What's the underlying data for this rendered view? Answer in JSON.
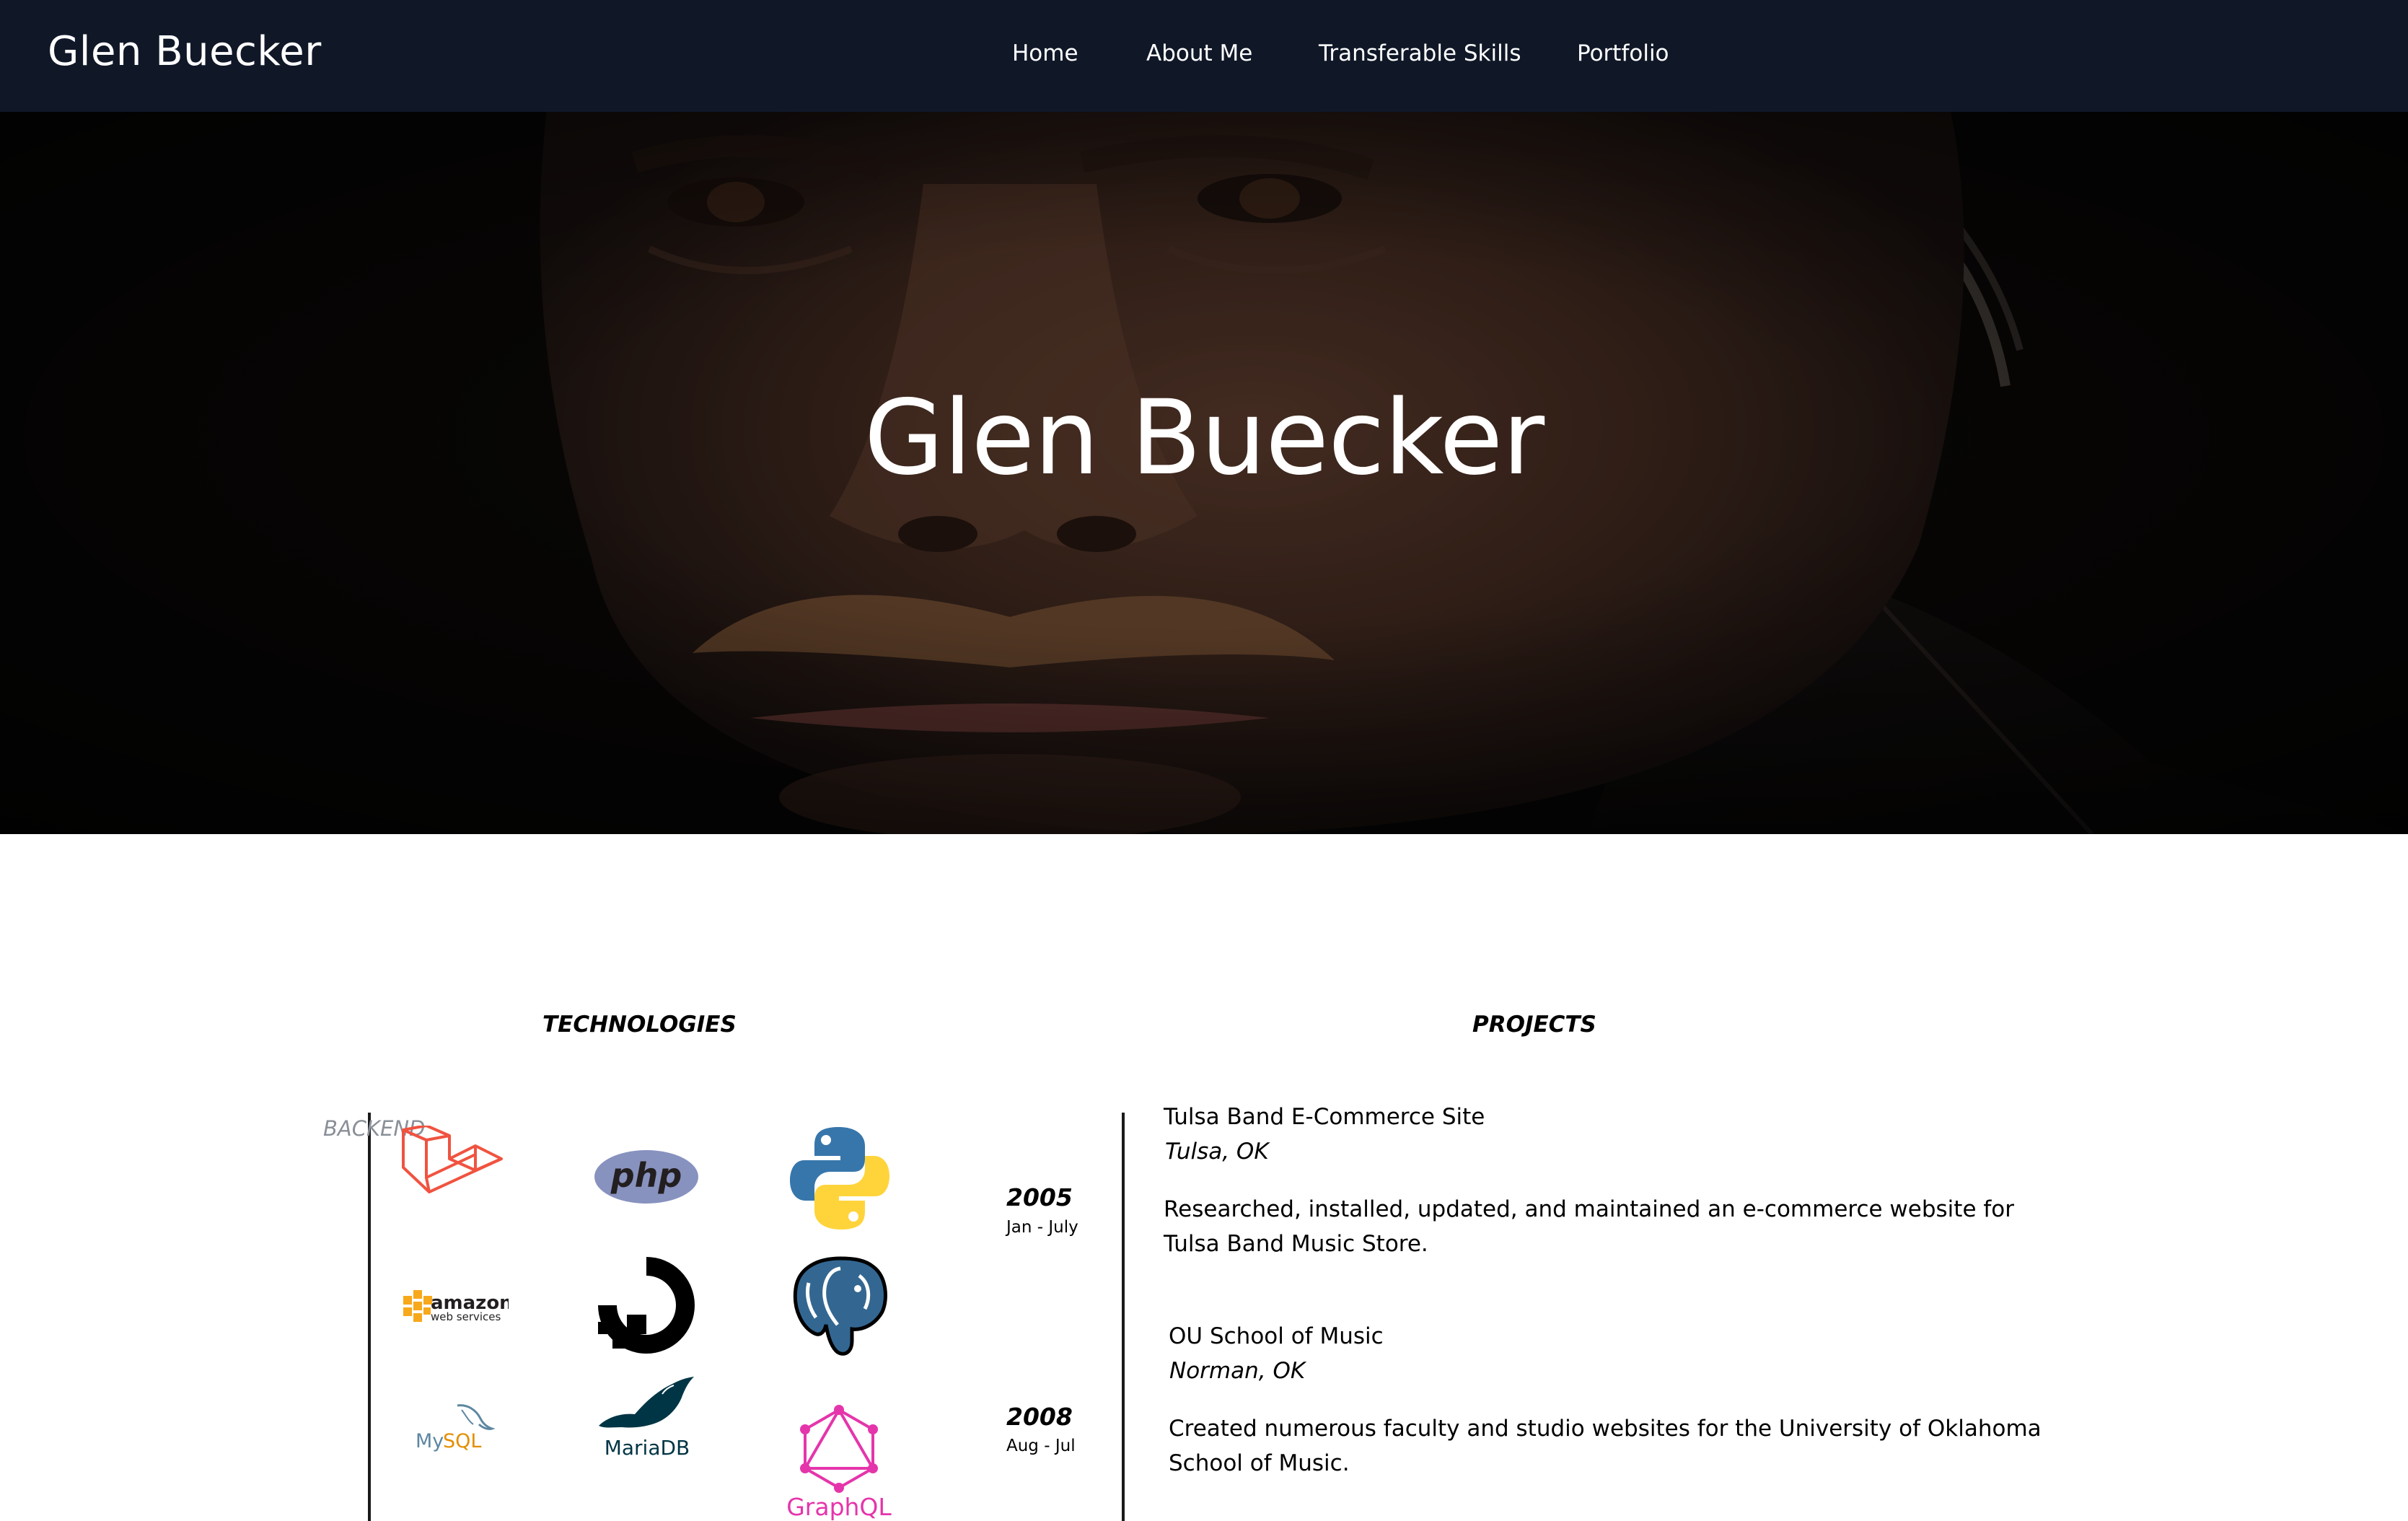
{
  "brand": "Glen Buecker",
  "nav": {
    "home": "Home",
    "about": "About Me",
    "skills": "Transferable Skills",
    "portfolio": "Portfolio"
  },
  "hero": {
    "title": "Glen Buecker"
  },
  "technologies": {
    "heading": "TECHNOLOGIES",
    "category": "BACKEND",
    "logos": [
      {
        "icon": "laravel-icon",
        "label": ""
      },
      {
        "icon": "php-icon",
        "label": "php"
      },
      {
        "icon": "python-icon",
        "label": ""
      },
      {
        "icon": "amazon-web-services-icon",
        "label": "amazon",
        "sublabel": "web services"
      },
      {
        "icon": "digitalocean-icon",
        "label": ""
      },
      {
        "icon": "postgresql-icon",
        "label": ""
      },
      {
        "icon": "mysql-icon",
        "label_my": "My",
        "label_sql": "SQL"
      },
      {
        "icon": "mariadb-icon",
        "label": "MariaDB"
      },
      {
        "icon": "graphql-icon",
        "label": "GraphQL"
      }
    ]
  },
  "projects": {
    "heading": "PROJECTS",
    "items": [
      {
        "year": "2005",
        "period": "Jan - July",
        "title": "Tulsa Band E-Commerce Site",
        "location": "Tulsa, OK",
        "description": "Researched, installed, updated, and maintained an e-commerce website for Tulsa Band Music Store."
      },
      {
        "year": "2008",
        "period": "Aug - Jul",
        "title": "OU School of Music",
        "location": "Norman, OK",
        "description": "Created numerous faculty and studio websites for the University of Oklahoma School of Music."
      }
    ]
  },
  "colors": {
    "navbar": "#101828",
    "laravel": "#f05340",
    "php": "#8892bf",
    "python_blue": "#3776ab",
    "python_yellow": "#ffd43b",
    "aws_orange": "#f7a81b",
    "postgres": "#336791",
    "mysql_blue": "#5d87a1",
    "mysql_orange": "#e48e00",
    "mariadb": "#003545",
    "graphql": "#e535ab"
  }
}
